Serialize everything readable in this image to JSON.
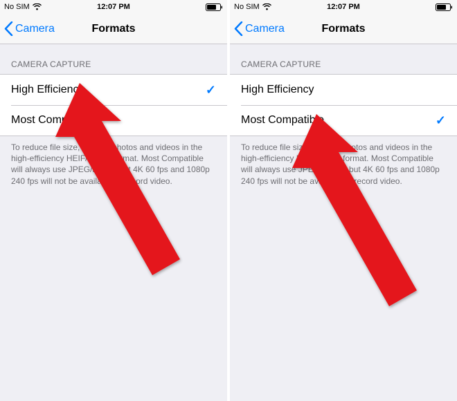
{
  "status": {
    "carrier": "No SIM",
    "time": "12:07 PM"
  },
  "nav": {
    "back_label": "Camera",
    "title": "Formats"
  },
  "section": {
    "header": "CAMERA CAPTURE",
    "footer": "To reduce file size, capture photos and videos in the high-efficiency HEIF/HEVC format. Most Compatible will always use JPEG/H.264, but 4K 60 fps and 1080p 240 fps will not be available to record video."
  },
  "options": {
    "high_efficiency": "High Efficiency",
    "most_compatible": "Most Compatible"
  },
  "screens": [
    {
      "selected": "high_efficiency",
      "arrow_target": "high_efficiency"
    },
    {
      "selected": "most_compatible",
      "arrow_target": "most_compatible"
    }
  ]
}
